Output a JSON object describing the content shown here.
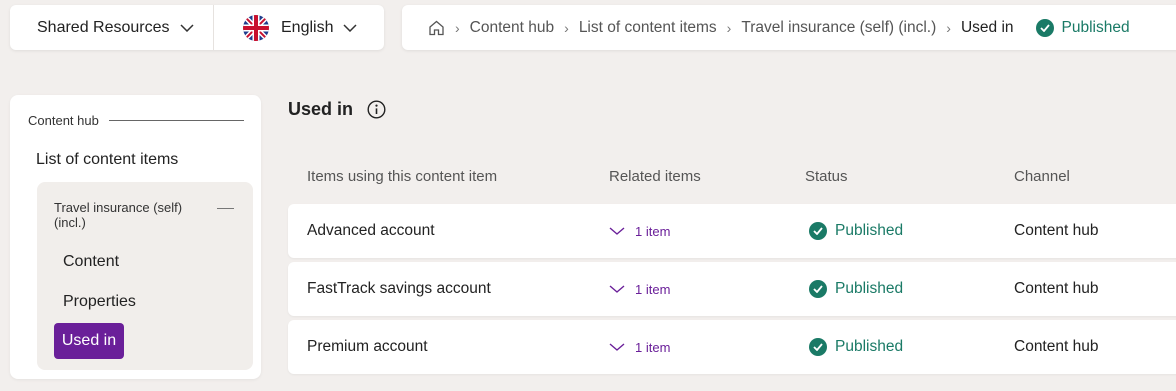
{
  "header": {
    "workspace_selector": "Shared Resources",
    "language_selector": "English"
  },
  "breadcrumb": {
    "items": [
      "Content hub",
      "List of content items",
      "Travel insurance (self) (incl.)",
      "Used in"
    ],
    "status": "Published"
  },
  "sidebar": {
    "section_title": "Content hub",
    "list_link": "List of content items",
    "group_title": "Travel insurance (self) (incl.)",
    "sub_items": [
      "Content",
      "Properties",
      "Used in"
    ],
    "active_item": "Used in"
  },
  "main": {
    "title": "Used in",
    "columns": [
      "Items using this content item",
      "Related items",
      "Status",
      "Channel"
    ],
    "rows": [
      {
        "name": "Advanced account",
        "related": "1 item",
        "status": "Published",
        "channel": "Content hub"
      },
      {
        "name": "FastTrack savings account",
        "related": "1 item",
        "status": "Published",
        "channel": "Content hub"
      },
      {
        "name": "Premium account",
        "related": "1 item",
        "status": "Published",
        "channel": "Content hub"
      }
    ]
  },
  "colors": {
    "accent_purple": "#6a1f99",
    "status_green": "#1a7a66",
    "background": "#f2efed"
  },
  "icons": [
    "chevron-down-icon",
    "uk-flag-icon",
    "home-icon",
    "chevron-right-icon",
    "check-circle-icon",
    "info-icon"
  ]
}
